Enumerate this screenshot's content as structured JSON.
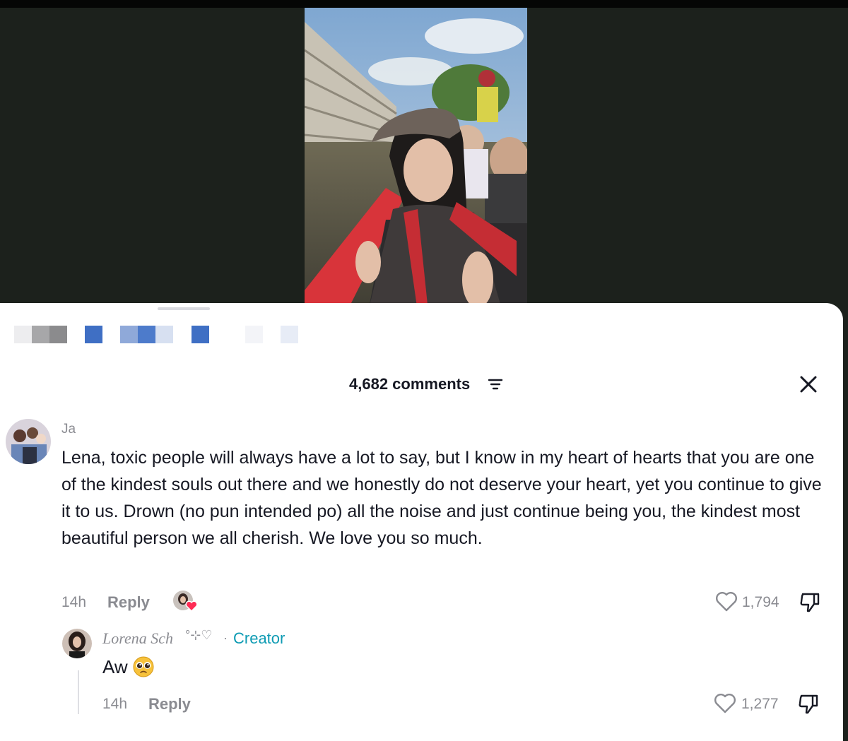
{
  "comments_header": {
    "count_label": "4,682 comments"
  },
  "comments": [
    {
      "author": "Ja",
      "text": "Lena, toxic people will always have a lot to say, but I know in my heart of hearts that you are one of the kindest souls out there and we honestly do not deserve your heart, yet you continue to give it to us. Drown (no pun intended po) all the noise and just continue being you, the kindest most beautiful person we all cherish. We love you so much.",
      "time": "14h",
      "reply_label": "Reply",
      "likes": "1,794",
      "replies": [
        {
          "author": "Lorena Sch",
          "author_suffix": "°⊹♡",
          "separator": "·",
          "badge": "Creator",
          "text": "Aw",
          "time": "14h",
          "reply_label": "Reply",
          "likes": "1,277"
        }
      ]
    }
  ],
  "icons": {
    "close": "close-icon",
    "filter": "filter-icon",
    "like": "heart-outline-icon",
    "dislike": "thumbs-down-icon",
    "emoji": "pleading-face-emoji"
  },
  "colors": {
    "creator_badge": "#0e9bb3",
    "heart_badge": "#fe2c55",
    "sheet_bg": "#ffffff"
  }
}
